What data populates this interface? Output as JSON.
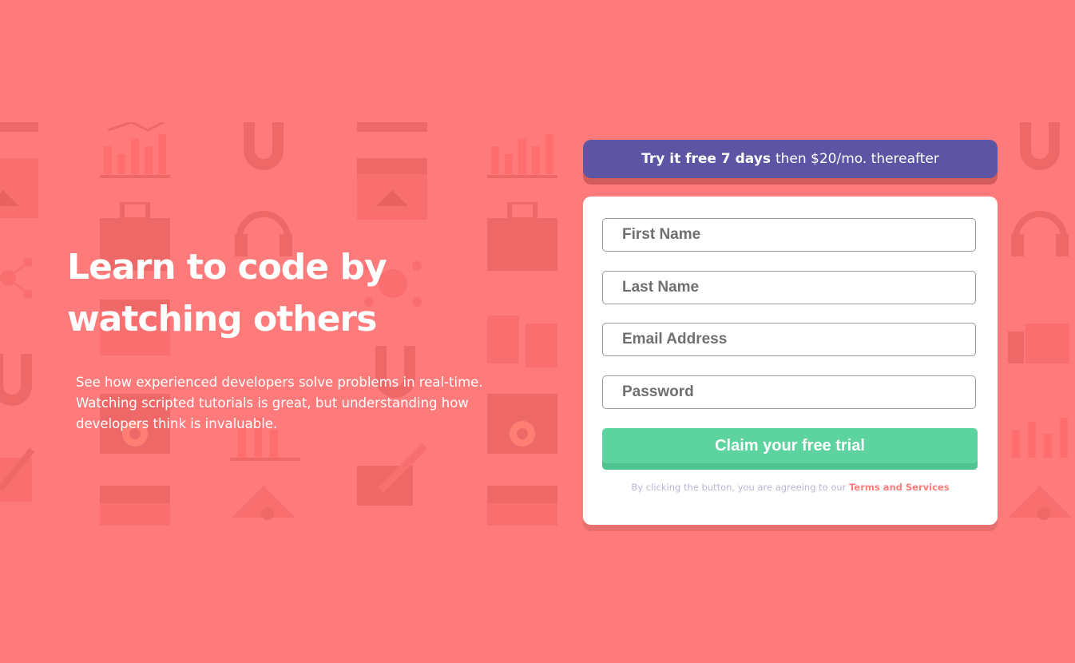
{
  "hero": {
    "title_line_1": "Learn to code by",
    "title_line_2": "watching others",
    "description": "See how experienced developers solve problems in real-time. Watching scripted tutorials is great, but understanding how developers think is invaluable."
  },
  "offer": {
    "bold": "Try it free 7 days",
    "rest": "then $20/mo. thereafter"
  },
  "form": {
    "first_name_placeholder": "First Name",
    "last_name_placeholder": "Last Name",
    "email_placeholder": "Email Address",
    "password_placeholder": "Password",
    "submit_label": "Claim your free trial",
    "terms_text": "By clicking the button, you are agreeing to our",
    "terms_link": "Terms and Services"
  },
  "colors": {
    "background": "#ff7a7a",
    "offer_banner": "#5e54a4",
    "submit_button": "#5dd39f",
    "terms_link": "#ff7a7a"
  },
  "background_icons": [
    "chart-icon",
    "magnet-icon",
    "browser-icon",
    "toolbox-icon",
    "headset-icon",
    "network-icon",
    "puzzle-icon",
    "gear-icon",
    "pencil-icon",
    "thumbs-up-icon",
    "eye-icon"
  ]
}
